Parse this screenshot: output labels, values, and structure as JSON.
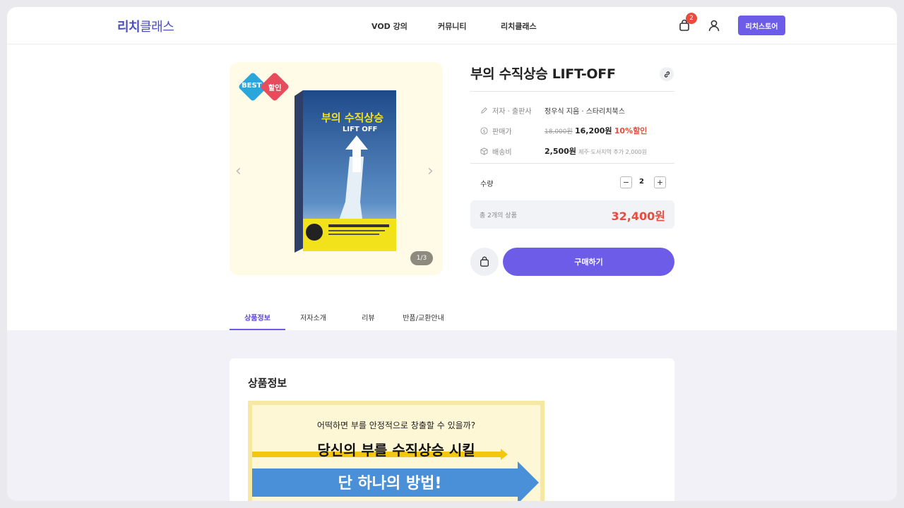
{
  "header": {
    "logo_bold": "리치",
    "logo_light": "클래스",
    "nav": [
      "VOD 강의",
      "커뮤니티",
      "리치클래스"
    ],
    "cart_count": "2",
    "store_button": "리치스토어"
  },
  "gallery": {
    "badge_best": "BEST",
    "badge_sale": "할인",
    "counter": "1/3",
    "book_title_main": "부의 수직상승",
    "book_title_sub": "LIFT OFF"
  },
  "product": {
    "title": "부의 수직상승 LIFT-OFF",
    "author_label": "저자 · 출판사",
    "author_value": "정우식 지음 · 스타리치북스",
    "price_label": "판매가",
    "original_price": "18,000원",
    "sale_price": "16,200원",
    "discount": "10%할인",
    "shipping_label": "배송비",
    "shipping_value": "2,500원",
    "shipping_note": "제주·도서지역 추가 2,000원",
    "qty_label": "수량",
    "qty_value": "2",
    "total_label": "총 2개의 상품",
    "total_value": "32,400원",
    "buy_button": "구매하기"
  },
  "tabs": [
    "상품정보",
    "저자소개",
    "리뷰",
    "반품/교환안내"
  ],
  "content": {
    "section_title": "상품정보",
    "banner_line1": "어떡하면 부를 안정적으로 창출할 수 있을까?",
    "banner_line2": "당신의 부를 수직상승 시킬",
    "banner_line3": "단 하나의 방법!"
  },
  "colors": {
    "accent": "#6c5ce7",
    "discount": "#e74c3c",
    "badge_best": "#2aa6dc",
    "badge_sale": "#e74c5c"
  }
}
